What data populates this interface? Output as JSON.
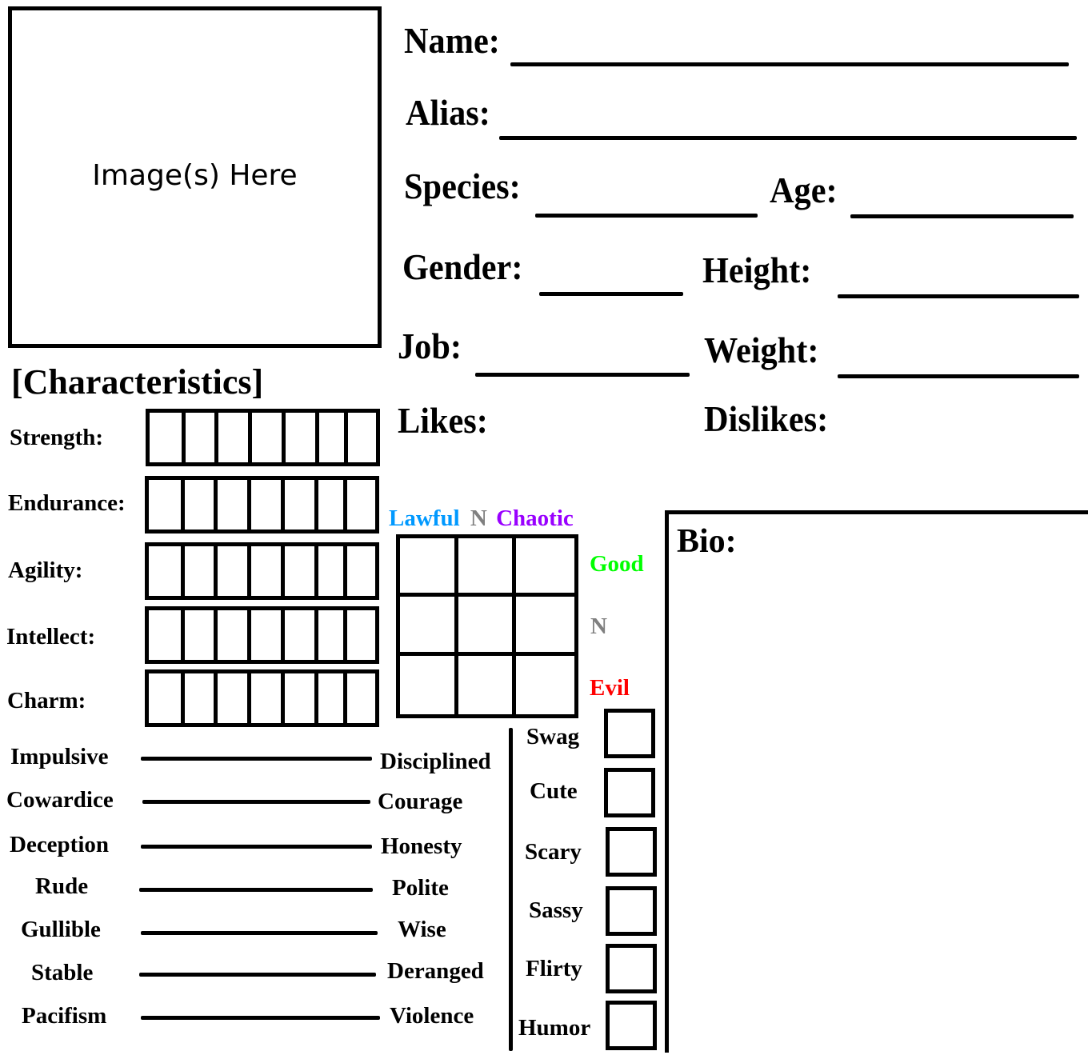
{
  "image_box": {
    "placeholder": "Image(s) Here"
  },
  "fields": {
    "name": "Name:",
    "alias": "Alias:",
    "species": "Species:",
    "age": "Age:",
    "gender": "Gender:",
    "height": "Height:",
    "job": "Job:",
    "weight": "Weight:",
    "likes": "Likes:",
    "dislikes": "Dislikes:"
  },
  "characteristics": {
    "title": "[Characteristics]",
    "cells_per_stat": 7,
    "stats": [
      {
        "label": "Strength:"
      },
      {
        "label": "Endurance:"
      },
      {
        "label": "Agility:"
      },
      {
        "label": "Intellect:"
      },
      {
        "label": "Charm:"
      }
    ]
  },
  "alignment": {
    "lawful": "Lawful",
    "neutral_h": "N",
    "chaotic": "Chaotic",
    "good": "Good",
    "neutral_v": "N",
    "evil": "Evil",
    "colors": {
      "lawful": "#0099ff",
      "neutral": "#808080",
      "chaotic": "#9900ff",
      "good": "#00ff00",
      "evil": "#ff0000"
    }
  },
  "bio": {
    "label": "Bio:"
  },
  "trait_scales": [
    {
      "left": "Impulsive",
      "right": "Disciplined"
    },
    {
      "left": "Cowardice",
      "right": "Courage"
    },
    {
      "left": "Deception",
      "right": "Honesty"
    },
    {
      "left": "Rude",
      "right": "Polite"
    },
    {
      "left": "Gullible",
      "right": "Wise"
    },
    {
      "left": "Stable",
      "right": "Deranged"
    },
    {
      "left": "Pacifism",
      "right": "Violence"
    }
  ],
  "traits": [
    {
      "label": "Swag"
    },
    {
      "label": "Cute"
    },
    {
      "label": "Scary"
    },
    {
      "label": "Sassy"
    },
    {
      "label": "Flirty"
    },
    {
      "label": "Humor"
    }
  ]
}
